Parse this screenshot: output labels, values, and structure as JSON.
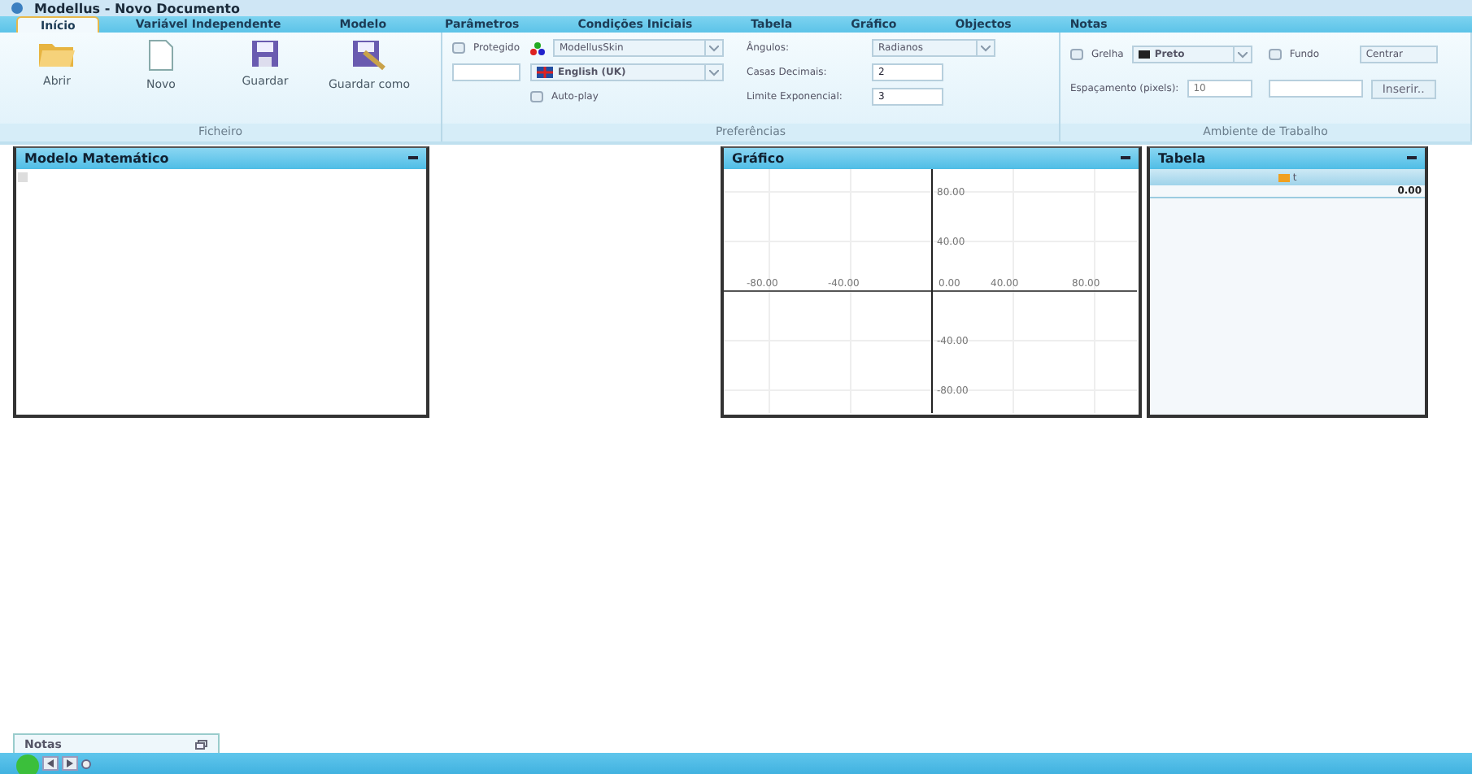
{
  "window": {
    "title": "Modellus - Novo Documento"
  },
  "tabs": [
    {
      "label": "Início",
      "selected": true
    },
    {
      "label": "Variável Independente",
      "selected": false
    },
    {
      "label": "Modelo",
      "selected": false
    },
    {
      "label": "Parâmetros",
      "selected": false
    },
    {
      "label": "Condições Iniciais",
      "selected": false
    },
    {
      "label": "Tabela",
      "selected": false
    },
    {
      "label": "Gráfico",
      "selected": false
    },
    {
      "label": "Objectos",
      "selected": false
    },
    {
      "label": "Notas",
      "selected": false
    }
  ],
  "ficheiro": {
    "label": "Ficheiro",
    "buttons": [
      {
        "label": "Abrir",
        "kind": "open"
      },
      {
        "label": "Novo",
        "kind": "new"
      },
      {
        "label": "Guardar",
        "kind": "save"
      },
      {
        "label": "Guardar como",
        "kind": "saveas"
      }
    ]
  },
  "preferencias": {
    "label": "Preferências",
    "protegido": {
      "label": "Protegido",
      "checked": false
    },
    "skin": "ModellusSkin",
    "language": "English (UK)",
    "autoplay": {
      "label": "Auto-play",
      "checked": false
    },
    "angulos": {
      "label": "Ângulos:",
      "value": "Radianos"
    },
    "casas": {
      "label": "Casas Decimais:",
      "value": "2"
    },
    "limite": {
      "label": "Limite Exponencial:",
      "value": "3"
    }
  },
  "ambiente": {
    "label": "Ambiente de Trabalho",
    "grelha": {
      "label": "Grelha",
      "checked": false
    },
    "cor": "Preto",
    "fundo": {
      "label": "Fundo",
      "checked": false
    },
    "posicao": "Centrar",
    "espacamento": {
      "label": "Espaçamento (pixels):",
      "placeholder": "10"
    },
    "inserir": "Inserir.."
  },
  "modelo": {
    "title": "Modelo Matemático"
  },
  "grafico": {
    "title": "Gráfico",
    "x_tick_labels": [
      "-80.00",
      "-40.00",
      "0.00",
      "40.00",
      "80.00"
    ],
    "y_tick_labels": [
      "80.00",
      "40.00",
      "-40.00",
      "-80.00"
    ]
  },
  "tabela": {
    "title": "Tabela",
    "column": "t",
    "value": "0.00"
  },
  "notas": {
    "title": "Notas"
  }
}
